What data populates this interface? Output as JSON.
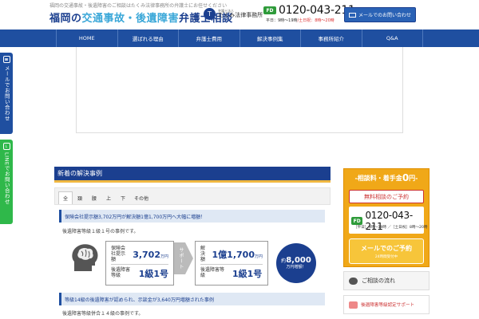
{
  "header": {
    "tagline": "福岡の交通事故・後遺障害のご相談はたくみ法律事務所の弁護士にお任せください",
    "logo_pre": "福岡の",
    "logo_accent": "交通事故・後遺障害",
    "logo_post": "弁護士相談",
    "firm_sub": "弁護士法人",
    "firm_name": "たくみ法律事務所",
    "firm_mark": "T",
    "freedial_label": "FD",
    "phone": "0120-043-211",
    "hours_weekday": "平日：9時〜19時",
    "hours_weekend": "/土日祝：8時〜20時",
    "mail_button": "メールでのお問い合わせ"
  },
  "nav": {
    "items": [
      "HOME",
      "選ばれる理由",
      "弁護士費用",
      "解決事例集",
      "事務所紹介",
      "Q&A"
    ]
  },
  "side": {
    "mail_label": "メールでお問い合わせ",
    "line_label": "LINEでお問い合わせ",
    "mail_icon": "☎",
    "line_icon": "L"
  },
  "cases": {
    "title": "新着の解決事例",
    "tabs": [
      "全",
      "頚",
      "腰",
      "上",
      "下",
      "その他"
    ],
    "case1_head": "保険会社提示額3,702万円が解決額1億1,700万円へ大幅に増額！",
    "case1_desc": "後遺障害等級１級１号の事例です。",
    "offer_label": "保険会社提示額",
    "offer_value": "3,702",
    "offer_unit": "万円",
    "grade_label": "後遺障害等級",
    "grade_value": "1級1号",
    "support_label": "サポート",
    "result_label": "解決額",
    "result_value": "1億1,700",
    "result_unit": "万円",
    "circle_prefix": "約",
    "circle_value": "8,000",
    "circle_sub": "万円増額！",
    "case2_head": "等級14級の後遺障害が認められ、示談金が3,640万円増額された事例",
    "case2_desc": "後遺障害等級併合１４級の事例です。"
  },
  "sidebar": {
    "promo_pre": "-相談料・着手金",
    "promo_big": "0",
    "promo_post": "円-",
    "free_consult": "無料相談のご予約",
    "freedial_label": "FD",
    "phone": "0120-043-211",
    "hours": "［平日］9時〜19時 ／［土日祝］8時〜20時",
    "mail_consult": "メールでのご予約",
    "mail_consult_sub": "24時間受付中",
    "flow": "ご相談の流れ",
    "cert": "後遺障害等級認定サポート"
  },
  "colors": {
    "brand_navy": "#1b3f8f",
    "nav_blue": "#1f4fa0",
    "line_green": "#2fb84a",
    "promo_orange": "#f0a818"
  }
}
